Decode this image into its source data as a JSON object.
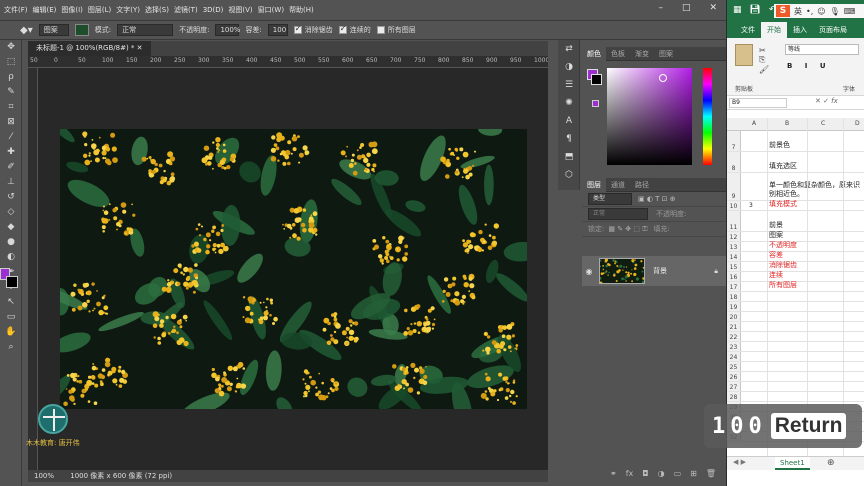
{
  "photoshop": {
    "menu": [
      "文件(F)",
      "编辑(E)",
      "图像(I)",
      "图层(L)",
      "文字(Y)",
      "选择(S)",
      "滤镜(T)",
      "3D(D)",
      "视图(V)",
      "窗口(W)",
      "帮助(H)"
    ],
    "options": {
      "fill_source": "图案",
      "mode_label": "模式:",
      "mode_value": "正常",
      "opacity_label": "不透明度:",
      "opacity_value": "100%",
      "tolerance_label": "容差:",
      "tolerance_value": "100",
      "antialias_label": "消除锯齿",
      "contiguous_label": "连续的",
      "all_layers_label": "所有图层"
    },
    "doc_tab": "未标题-1 @ 100%(RGB/8#) *",
    "ruler_marks": [
      "50",
      "0",
      "50",
      "100",
      "150",
      "200",
      "250",
      "300",
      "350",
      "400",
      "450",
      "500",
      "550",
      "600",
      "650",
      "700",
      "750",
      "800",
      "850",
      "900",
      "950",
      "1000"
    ],
    "status": {
      "zoom": "100%",
      "doc_info": "1000 像素 x 600 像素 (72 ppi)"
    },
    "watermark_text": "木木教育: 唐开伟",
    "color_panel_tabs": [
      "颜色",
      "色板",
      "渐变",
      "图案"
    ],
    "layers_panel_tabs": [
      "图层",
      "通道",
      "路径"
    ],
    "layers": {
      "filter_kind": "类型",
      "blend_mode": "正常",
      "opacity_label": "不透明度:",
      "lock_label": "锁定:",
      "fill_label": "填充:",
      "layer_name": "背景"
    },
    "colors": {
      "foreground": "#9b2fd1",
      "background": "#000000"
    }
  },
  "excel": {
    "title_tabs": [
      "文件",
      "开始",
      "插入",
      "页面布局"
    ],
    "ime": {
      "logo": "S",
      "lang": "英"
    },
    "font_name": "等线",
    "clipboard_label": "剪贴板",
    "font_group_label": "字体",
    "name_box": "B9",
    "columns": [
      "A",
      "B",
      "C",
      "D"
    ],
    "rows": [
      {
        "num": "7",
        "a": "",
        "b": "前景色",
        "red": false,
        "tall": true
      },
      {
        "num": "8",
        "a": "",
        "b": "填充选区",
        "red": false,
        "tall": true
      },
      {
        "num": "9",
        "a": "",
        "b": "单一颜色和复杂颜色，原来识别相近色。",
        "red": false,
        "tall": true
      },
      {
        "num": "10",
        "a": "3",
        "b": "填充模式",
        "red": true,
        "tall": false
      },
      {
        "num": "11",
        "a": "",
        "b": "前景",
        "red": false,
        "tall": true
      },
      {
        "num": "12",
        "a": "",
        "b": "图案",
        "red": false,
        "tall": false
      },
      {
        "num": "13",
        "a": "",
        "b": "不透明度",
        "red": true,
        "tall": false
      },
      {
        "num": "14",
        "a": "",
        "b": "容差",
        "red": true,
        "tall": false
      },
      {
        "num": "15",
        "a": "",
        "b": "消除锯齿",
        "red": true,
        "tall": false
      },
      {
        "num": "16",
        "a": "",
        "b": "连续",
        "red": true,
        "tall": false
      },
      {
        "num": "17",
        "a": "",
        "b": "所有图层",
        "red": true,
        "tall": false
      },
      {
        "num": "18",
        "a": "",
        "b": "",
        "red": false,
        "tall": false
      },
      {
        "num": "19",
        "a": "",
        "b": "",
        "red": false,
        "tall": false
      },
      {
        "num": "20",
        "a": "",
        "b": "",
        "red": false,
        "tall": false
      },
      {
        "num": "21",
        "a": "",
        "b": "",
        "red": false,
        "tall": false
      },
      {
        "num": "22",
        "a": "",
        "b": "",
        "red": false,
        "tall": false
      },
      {
        "num": "23",
        "a": "",
        "b": "",
        "red": false,
        "tall": false
      },
      {
        "num": "24",
        "a": "",
        "b": "",
        "red": false,
        "tall": false
      },
      {
        "num": "25",
        "a": "",
        "b": "",
        "red": false,
        "tall": false
      },
      {
        "num": "26",
        "a": "",
        "b": "",
        "red": false,
        "tall": false
      },
      {
        "num": "27",
        "a": "",
        "b": "",
        "red": false,
        "tall": false
      },
      {
        "num": "28",
        "a": "",
        "b": "",
        "red": false,
        "tall": false
      },
      {
        "num": "29",
        "a": "",
        "b": "",
        "red": false,
        "tall": false
      },
      {
        "num": "30",
        "a": "",
        "b": "",
        "red": false,
        "tall": false
      },
      {
        "num": "31",
        "a": "",
        "b": "",
        "red": false,
        "tall": false
      },
      {
        "num": "32",
        "a": "",
        "b": "",
        "red": false,
        "tall": false
      }
    ],
    "sheet_tab": "Sheet1"
  },
  "key_overlay": {
    "count": "100",
    "key": "Return"
  }
}
